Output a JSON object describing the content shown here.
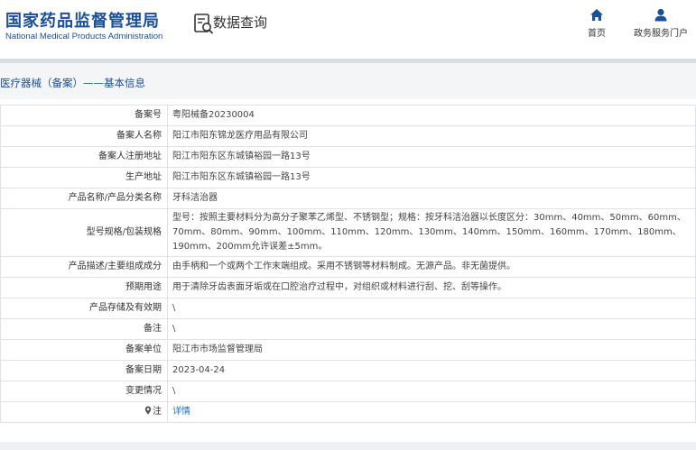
{
  "header": {
    "logo_cn": "国家药品监督管理局",
    "logo_en": "National Medical Products Administration",
    "query_title": "数据查询",
    "nav": [
      {
        "label": "首页",
        "icon": "home-icon"
      },
      {
        "label": "政务服务门户",
        "icon": "user-icon"
      }
    ]
  },
  "breadcrumb": {
    "category": "医疗器械（备案）",
    "separator": "——",
    "page": "基本信息"
  },
  "colors": {
    "brand": "#1a4f9c",
    "link": "#1a6fd0",
    "border": "#dfe2e6"
  },
  "rows": [
    {
      "label": "备案号",
      "value": "粤阳械备20230004"
    },
    {
      "label": "备案人名称",
      "value": "阳江市阳东锦龙医疗用品有限公司"
    },
    {
      "label": "备案人注册地址",
      "value": "阳江市阳东区东城镇裕园一路13号"
    },
    {
      "label": "生产地址",
      "value": "阳江市阳东区东城镇裕园一路13号"
    },
    {
      "label": "产品名称/产品分类名称",
      "value": "牙科洁治器"
    },
    {
      "label": "型号规格/包装规格",
      "value": "型号：按照主要材料分为高分子聚苯乙烯型、不锈钢型；规格：按牙科洁治器以长度区分：30mm、40mm、50mm、60mm、70mm、80mm、90mm、100mm、110mm、120mm、130mm、140mm、150mm、160mm、170mm、180mm、190mm、200mm允许误差±5mm。"
    },
    {
      "label": "产品描述/主要组成成分",
      "value": "由手柄和一个或两个工作末端组成。采用不锈钢等材料制成。无源产品。非无菌提供。"
    },
    {
      "label": "预期用途",
      "value": "用于清除牙齿表面牙垢或在口腔治疗过程中，对组织或材料进行刮、挖、刮等操作。"
    },
    {
      "label": "产品存储及有效期",
      "value": "\\"
    },
    {
      "label": "备注",
      "value": "\\"
    },
    {
      "label": "备案单位",
      "value": "阳江市市场监督管理局"
    },
    {
      "label": "备案日期",
      "value": "2023-04-24"
    },
    {
      "label": "变更情况",
      "value": "\\"
    },
    {
      "label": "注",
      "value": "详情"
    }
  ]
}
